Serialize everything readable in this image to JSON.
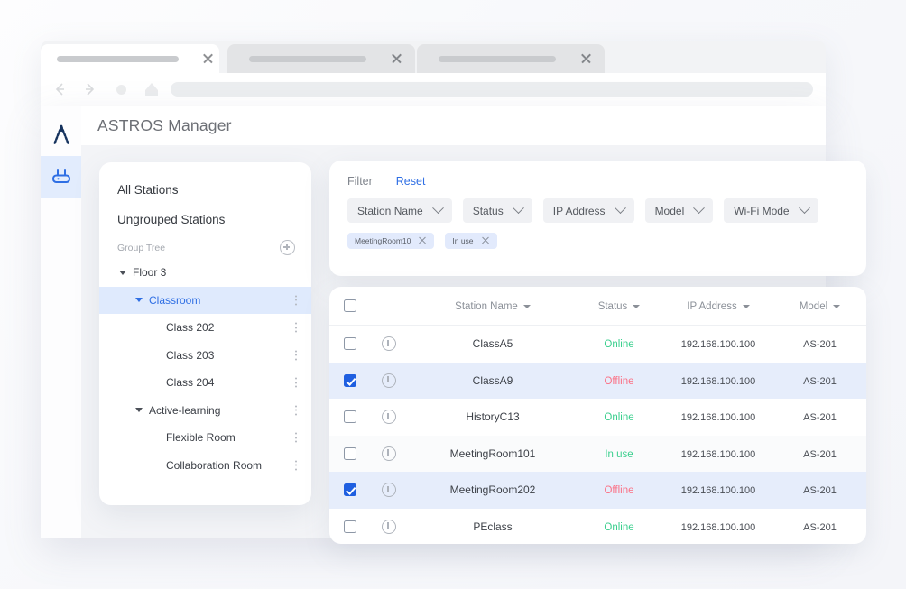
{
  "browser": {
    "tabs": [
      {
        "id": "tab-1",
        "state": "active"
      },
      {
        "id": "tab-2",
        "state": "idle"
      },
      {
        "id": "tab-3",
        "state": "idle"
      }
    ],
    "nav": {
      "back_icon": "arrow-left-icon",
      "forward_icon": "arrow-right-icon",
      "reload_icon": "reload-icon",
      "home_icon": "home-icon",
      "url_value": "",
      "url_placeholder": ""
    }
  },
  "app": {
    "title": "ASTROS Manager",
    "rail": [
      {
        "name": "astros-logo-icon",
        "selected": false
      },
      {
        "name": "access-point-icon",
        "selected": true
      }
    ]
  },
  "tree_panel": {
    "top_items": [
      {
        "label": "All Stations"
      },
      {
        "label": "Ungrouped Stations"
      }
    ],
    "section_label": "Group Tree",
    "add_icon": "plus-circle-icon",
    "nodes": [
      {
        "label": "Floor 3",
        "indent": 0,
        "caret": true,
        "selected": false,
        "menu": false
      },
      {
        "label": "Classroom",
        "indent": 1,
        "caret": true,
        "selected": true,
        "menu": true
      },
      {
        "label": "Class 202",
        "indent": 2,
        "caret": false,
        "selected": false,
        "menu": true
      },
      {
        "label": "Class 203",
        "indent": 2,
        "caret": false,
        "selected": false,
        "menu": true
      },
      {
        "label": "Class 204",
        "indent": 2,
        "caret": false,
        "selected": false,
        "menu": true
      },
      {
        "label": "Active-learning",
        "indent": 1,
        "caret": true,
        "selected": false,
        "menu": true
      },
      {
        "label": "Flexible Room",
        "indent": 2,
        "caret": false,
        "selected": false,
        "menu": true
      },
      {
        "label": "Collaboration Room",
        "indent": 2,
        "caret": false,
        "selected": false,
        "menu": true
      }
    ]
  },
  "filter_panel": {
    "label": "Filter",
    "reset_label": "Reset",
    "selects": [
      {
        "label": "Station Name"
      },
      {
        "label": "Status"
      },
      {
        "label": "IP Address"
      },
      {
        "label": "Model"
      },
      {
        "label": "Wi-Fi Mode"
      }
    ],
    "chips": [
      {
        "label": "MeetingRoom10"
      },
      {
        "label": "In use"
      }
    ]
  },
  "table": {
    "columns": [
      {
        "key": "name",
        "label": "Station Name",
        "sortable": true
      },
      {
        "key": "status",
        "label": "Status",
        "sortable": true
      },
      {
        "key": "ip",
        "label": "IP Address",
        "sortable": true
      },
      {
        "key": "model",
        "label": "Model",
        "sortable": true
      }
    ],
    "header_checkbox_checked": false,
    "rows": [
      {
        "checked": false,
        "name": "ClassA5",
        "status": "Online",
        "status_kind": "online",
        "ip": "192.168.100.100",
        "model": "AS-201"
      },
      {
        "checked": true,
        "name": "ClassA9",
        "status": "Offline",
        "status_kind": "offline",
        "ip": "192.168.100.100",
        "model": "AS-201"
      },
      {
        "checked": false,
        "name": "HistoryC13",
        "status": "Online",
        "status_kind": "online",
        "ip": "192.168.100.100",
        "model": "AS-201"
      },
      {
        "checked": false,
        "name": "MeetingRoom101",
        "status": "In use",
        "status_kind": "inuse",
        "ip": "192.168.100.100",
        "model": "AS-201"
      },
      {
        "checked": true,
        "name": "MeetingRoom202",
        "status": "Offline",
        "status_kind": "offline",
        "ip": "192.168.100.100",
        "model": "AS-201"
      },
      {
        "checked": false,
        "name": "PEclass",
        "status": "Online",
        "status_kind": "online",
        "ip": "192.168.100.100",
        "model": "AS-201"
      }
    ]
  },
  "colors": {
    "accent": "#2f6fe4",
    "checkbox_checked": "#1f5fe0",
    "status_online": "#3bcf8e",
    "status_offline": "#fb7185",
    "row_selected_bg": "#e6edfb",
    "tree_selected_bg": "#dfeafd"
  }
}
